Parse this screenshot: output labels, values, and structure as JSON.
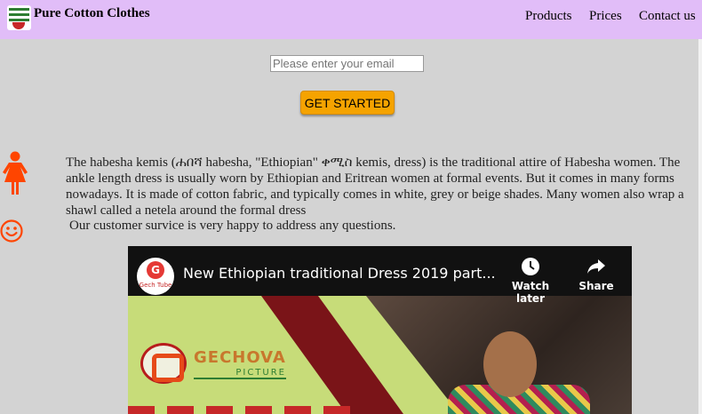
{
  "header": {
    "brand": "Pure Cotton Clothes",
    "nav": [
      "Products",
      "Prices",
      "Contact us"
    ]
  },
  "signup": {
    "email_placeholder": "Please enter your email",
    "cta_label": "GET STARTED"
  },
  "content": {
    "description": "The habesha kemis (ሐበሻ habesha, \"Ethiopian\" ቀሚስ kemis, dress) is the traditional attire of Habesha women. The ankle length dress is usually worn by Ethiopian and Eritrean women at formal events. But it comes in many forms nowadays. It is made of cotton fabric, and typically comes in white, grey or beige shades. Many women also wrap a shawl called a netela around the formal dress",
    "service_note": "Our customer survice is very happy to address any questions."
  },
  "video": {
    "title": "New Ethiopian traditional Dress 2019 part...",
    "channel_initial": "G",
    "channel_label": "Gech Tube",
    "watch_later": "Watch later",
    "share": "Share",
    "thumb_brand": "GECHOVA",
    "thumb_sub": "PICTURE"
  },
  "colors": {
    "navbar": "#e1bdf8",
    "page_bg": "#d3d3d3",
    "cta": "#f5a300",
    "icon_accent": "#ff4500"
  },
  "icons": [
    "woman-icon",
    "smile-icon",
    "clock-icon",
    "share-icon"
  ]
}
